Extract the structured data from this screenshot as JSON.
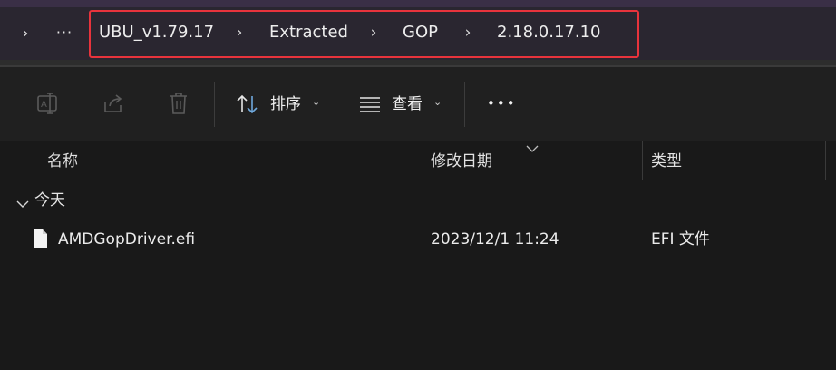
{
  "address_bar": {
    "back_chevron": "›",
    "more": "···",
    "breadcrumbs": [
      "UBU_v1.79.17",
      "Extracted",
      "GOP",
      "2.18.0.17.10"
    ],
    "separator": "›",
    "highlight_color": "#e8333c"
  },
  "toolbar": {
    "rename_icon": "rename-icon",
    "share_icon": "share-icon",
    "delete_icon": "trash-icon",
    "sort_label": "排序",
    "view_label": "查看",
    "caret": "⌄",
    "more_label": "•••"
  },
  "columns": {
    "name": "名称",
    "modified": "修改日期",
    "type": "类型"
  },
  "group": {
    "label": "今天"
  },
  "files": [
    {
      "name": "AMDGopDriver.efi",
      "modified": "2023/12/1 11:24",
      "type": "EFI 文件"
    }
  ]
}
